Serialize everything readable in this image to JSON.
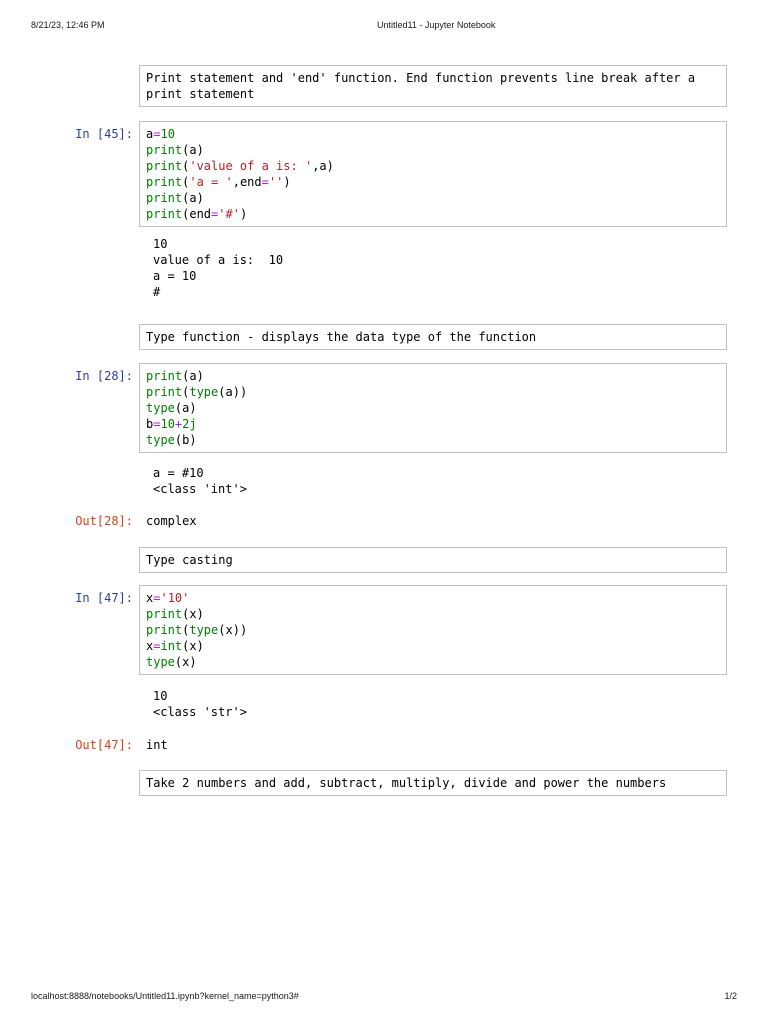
{
  "header": {
    "date": "8/21/23, 12:46 PM",
    "title": "Untitled11 - Jupyter Notebook"
  },
  "footer": {
    "url": "localhost:8888/notebooks/Untitled11.ipynb?kernel_name=python3#",
    "page_indicator": "1/2"
  },
  "colors": {
    "in_prompt": "#303F9F",
    "out_prompt": "#D84315",
    "builtin": "#008000",
    "string": "#BA2121",
    "operator": "#AA22FF",
    "number": "#008000",
    "cell_border": "#c0c0c0"
  },
  "cells": [
    {
      "kind": "markdown",
      "text": "Print statement and 'end' function. End function prevents line break after a print statement"
    },
    {
      "kind": "code",
      "prompt": "In [45]:",
      "lines": [
        [
          {
            "t": "a",
            "c": "p"
          },
          {
            "t": "=",
            "c": "o"
          },
          {
            "t": "10",
            "c": "n"
          }
        ],
        [
          {
            "t": "print",
            "c": "b"
          },
          {
            "t": "(a)",
            "c": "p"
          }
        ],
        [
          {
            "t": "print",
            "c": "b"
          },
          {
            "t": "(",
            "c": "p"
          },
          {
            "t": "'value of a is: '",
            "c": "s"
          },
          {
            "t": ",a)",
            "c": "p"
          }
        ],
        [
          {
            "t": "print",
            "c": "b"
          },
          {
            "t": "(",
            "c": "p"
          },
          {
            "t": "'a = '",
            "c": "s"
          },
          {
            "t": ",end",
            "c": "p"
          },
          {
            "t": "=",
            "c": "o"
          },
          {
            "t": "''",
            "c": "s"
          },
          {
            "t": ")",
            "c": "p"
          }
        ],
        [
          {
            "t": "print",
            "c": "b"
          },
          {
            "t": "(a)",
            "c": "p"
          }
        ],
        [
          {
            "t": "print",
            "c": "b"
          },
          {
            "t": "(end",
            "c": "p"
          },
          {
            "t": "=",
            "c": "o"
          },
          {
            "t": "'#'",
            "c": "s"
          },
          {
            "t": ")",
            "c": "p"
          }
        ]
      ]
    },
    {
      "kind": "output",
      "lines": [
        "10",
        "value of a is:  10",
        "a = 10",
        "#"
      ]
    },
    {
      "kind": "markdown",
      "text": "Type function - displays the data type of the function"
    },
    {
      "kind": "code",
      "prompt": "In [28]:",
      "lines": [
        [
          {
            "t": "print",
            "c": "b"
          },
          {
            "t": "(a)",
            "c": "p"
          }
        ],
        [
          {
            "t": "print",
            "c": "b"
          },
          {
            "t": "(",
            "c": "p"
          },
          {
            "t": "type",
            "c": "b"
          },
          {
            "t": "(a))",
            "c": "p"
          }
        ],
        [
          {
            "t": "type",
            "c": "b"
          },
          {
            "t": "(a)",
            "c": "p"
          }
        ],
        [
          {
            "t": "b",
            "c": "p"
          },
          {
            "t": "=",
            "c": "o"
          },
          {
            "t": "10",
            "c": "n"
          },
          {
            "t": "+",
            "c": "o"
          },
          {
            "t": "2j",
            "c": "n"
          }
        ],
        [
          {
            "t": "type",
            "c": "b"
          },
          {
            "t": "(b)",
            "c": "p"
          }
        ]
      ]
    },
    {
      "kind": "output",
      "lines": [
        "a = #10",
        "<class 'int'>"
      ]
    },
    {
      "kind": "out_result",
      "prompt": "Out[28]:",
      "text": "complex"
    },
    {
      "kind": "markdown",
      "text": "Type casting"
    },
    {
      "kind": "code",
      "prompt": "In [47]:",
      "lines": [
        [
          {
            "t": "x",
            "c": "p"
          },
          {
            "t": "=",
            "c": "o"
          },
          {
            "t": "'10'",
            "c": "s"
          }
        ],
        [
          {
            "t": "print",
            "c": "b"
          },
          {
            "t": "(x)",
            "c": "p"
          }
        ],
        [
          {
            "t": "print",
            "c": "b"
          },
          {
            "t": "(",
            "c": "p"
          },
          {
            "t": "type",
            "c": "b"
          },
          {
            "t": "(x))",
            "c": "p"
          }
        ],
        [
          {
            "t": "x",
            "c": "p"
          },
          {
            "t": "=",
            "c": "o"
          },
          {
            "t": "int",
            "c": "b"
          },
          {
            "t": "(x)",
            "c": "p"
          }
        ],
        [
          {
            "t": "type",
            "c": "b"
          },
          {
            "t": "(x)",
            "c": "p"
          }
        ]
      ]
    },
    {
      "kind": "output",
      "lines": [
        "10",
        "<class 'str'>"
      ]
    },
    {
      "kind": "out_result",
      "prompt": "Out[47]:",
      "text": "int"
    },
    {
      "kind": "markdown",
      "text": "Take 2 numbers and add, subtract, multiply, divide and power the numbers"
    }
  ]
}
